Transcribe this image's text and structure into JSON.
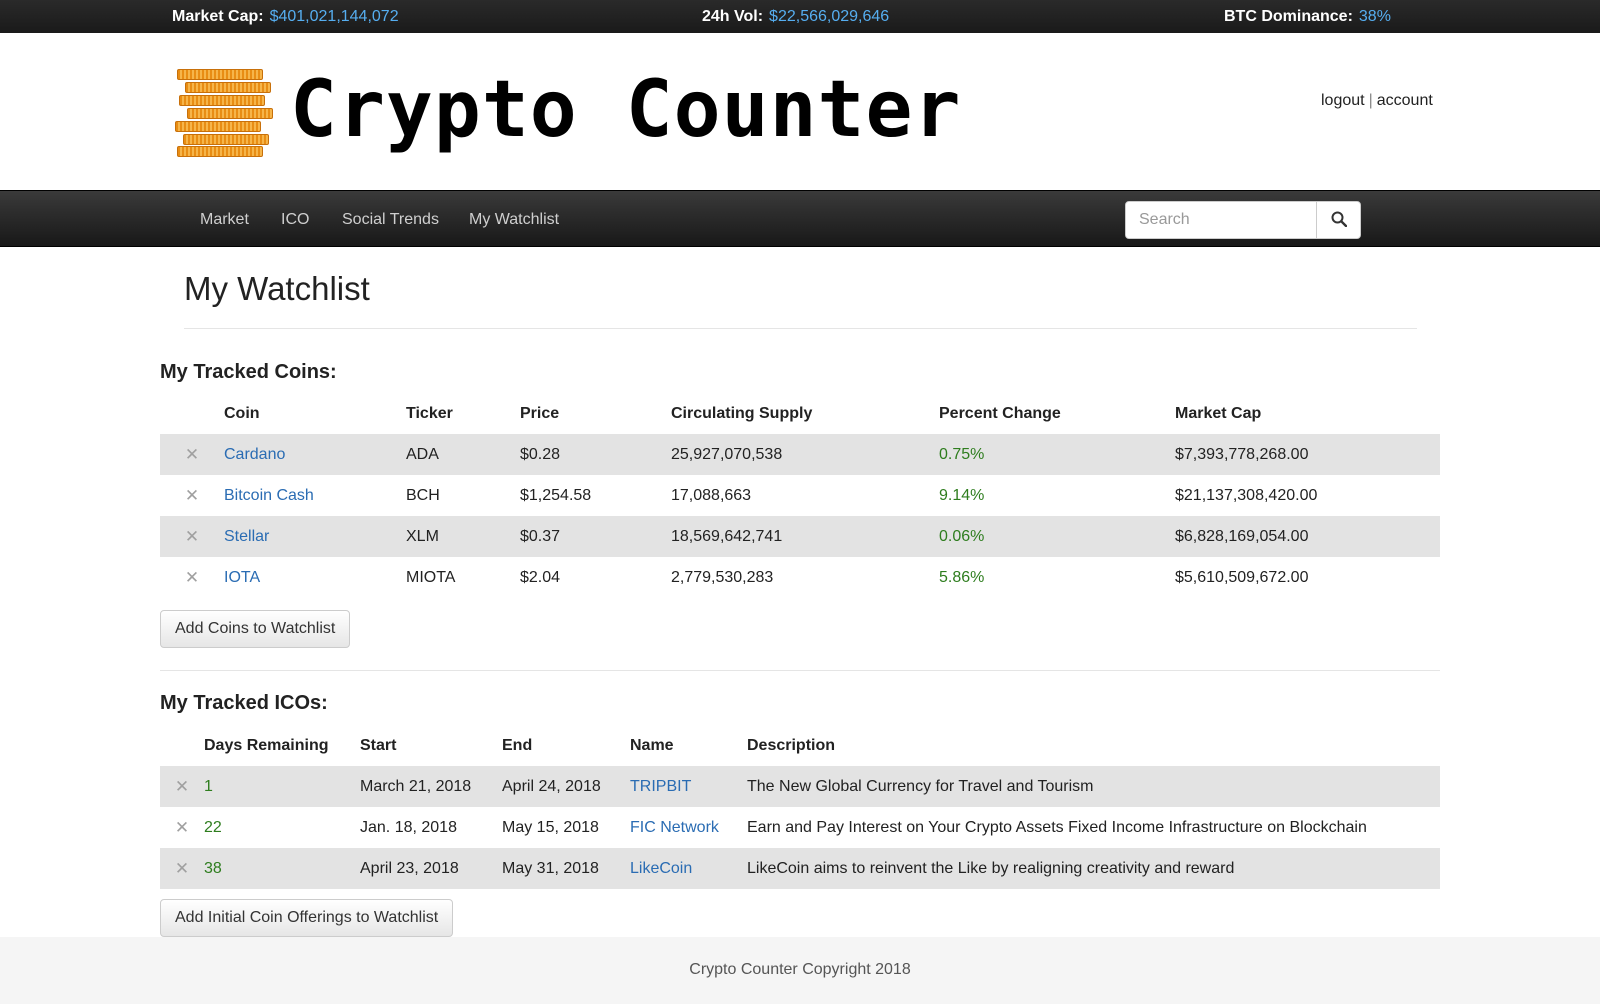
{
  "ticker": {
    "market_cap_label": "Market Cap:",
    "market_cap_value": "$401,021,144,072",
    "vol_label": "24h Vol:",
    "vol_value": "$22,566,029,646",
    "btc_label": "BTC Dominance:",
    "btc_value": "38%"
  },
  "header": {
    "brand": "Crypto Counter",
    "logout": "logout",
    "separator": "|",
    "account": "account"
  },
  "nav": {
    "items": [
      "Market",
      "ICO",
      "Social Trends",
      "My Watchlist"
    ],
    "search_placeholder": "Search"
  },
  "page": {
    "title": "My Watchlist"
  },
  "coins": {
    "title": "My Tracked Coins:",
    "headers": [
      "Coin",
      "Ticker",
      "Price",
      "Circulating Supply",
      "Percent Change",
      "Market Cap"
    ],
    "rows": [
      {
        "coin": "Cardano",
        "ticker": "ADA",
        "price": "$0.28",
        "supply": "25,927,070,538",
        "change": "0.75%",
        "cap": "$7,393,778,268.00"
      },
      {
        "coin": "Bitcoin Cash",
        "ticker": "BCH",
        "price": "$1,254.58",
        "supply": "17,088,663",
        "change": "9.14%",
        "cap": "$21,137,308,420.00"
      },
      {
        "coin": "Stellar",
        "ticker": "XLM",
        "price": "$0.37",
        "supply": "18,569,642,741",
        "change": "0.06%",
        "cap": "$6,828,169,054.00"
      },
      {
        "coin": "IOTA",
        "ticker": "MIOTA",
        "price": "$2.04",
        "supply": "2,779,530,283",
        "change": "5.86%",
        "cap": "$5,610,509,672.00"
      }
    ],
    "add_button": "Add Coins to Watchlist"
  },
  "icos": {
    "title": "My Tracked ICOs:",
    "headers": [
      "Days Remaining",
      "Start",
      "End",
      "Name",
      "Description"
    ],
    "rows": [
      {
        "days": "1",
        "start": "March 21, 2018",
        "end": "April 24, 2018",
        "name": "TRIPBIT",
        "description": "The New Global Currency for Travel and Tourism"
      },
      {
        "days": "22",
        "start": "Jan. 18, 2018",
        "end": "May 15, 2018",
        "name": "FIC Network",
        "description": "Earn and Pay Interest on Your Crypto Assets Fixed Income Infrastructure on Blockchain"
      },
      {
        "days": "38",
        "start": "April 23, 2018",
        "end": "May 31, 2018",
        "name": "LikeCoin",
        "description": "LikeCoin aims to reinvent the Like by realigning creativity and reward"
      }
    ],
    "add_button": "Add Initial Coin Offerings to Watchlist"
  },
  "footer": {
    "text": "Crypto Counter Copyright 2018"
  },
  "icons": {
    "remove": "x-icon",
    "search": "search-icon",
    "logo": "coin-stack-icon"
  },
  "colors": {
    "link": "#2a6cb3",
    "ticker_value": "#56aef0",
    "positive": "#2e7d1e",
    "logo": "#f0a030"
  }
}
